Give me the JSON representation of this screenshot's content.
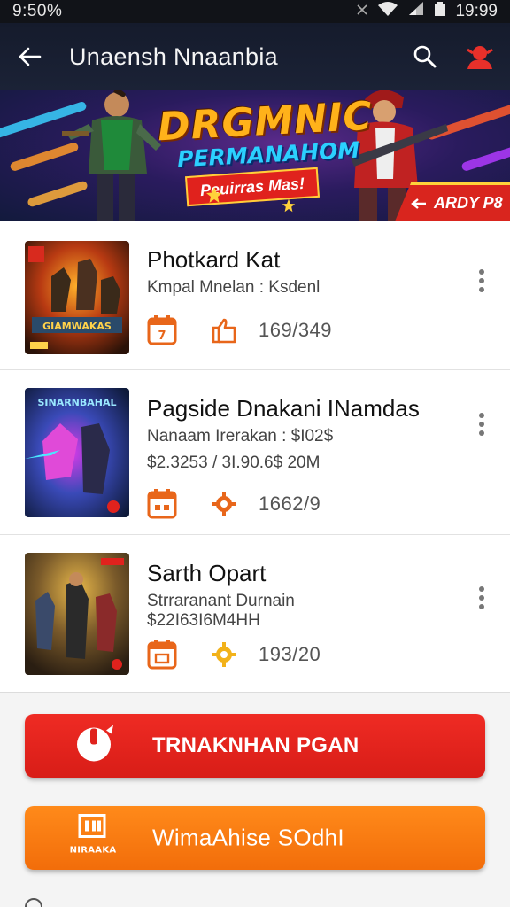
{
  "status_bar": {
    "time_left": "9:50%",
    "time_right": "19:99"
  },
  "app_bar": {
    "title": "Unaensh Nnaanbia",
    "icons": [
      "back-arrow-icon",
      "search-icon",
      "profile-icon"
    ],
    "profile_color": "#e8302a"
  },
  "banner": {
    "title": "DRGMNIC",
    "subtitle": "PERMANAHOM",
    "ribbon": "Peuirras Mas!",
    "tag": "ARDY P8"
  },
  "games": [
    {
      "title": "Photkard Kat",
      "subtitle": "Kmpal Mnelan : Ksdenl",
      "subtitle2": "",
      "count": "169/349",
      "thumb_label": "GIAMWAKAS",
      "meta_icons": [
        "calendar-icon",
        "thumb-up-icon"
      ]
    },
    {
      "title": "Pagside Dnakani INamdas",
      "subtitle": "Nanaam Irerakan : $I02$",
      "subtitle2": "$2.3253 / 3I.90.6$ 20M",
      "count": "1662/9",
      "thumb_label": "SINARNBAHAL",
      "meta_icons": [
        "calendar-icon",
        "gear-icon"
      ]
    },
    {
      "title": "Sarth Opart",
      "subtitle": "Strraranant Durnain",
      "subtitle2": "$22I63I6M4HH",
      "count": "193/20",
      "thumb_label": "",
      "meta_icons": [
        "calendar-icon",
        "gear-icon"
      ]
    }
  ],
  "buttons": {
    "primary": "TRNAKNHAN PGAN",
    "secondary": "WimaAhise SOdhI",
    "secondary_icon_caption": "NIRAAKA"
  },
  "colors": {
    "accent_red": "#e0221d",
    "accent_orange": "#f57a12",
    "icon_orange": "#e8661a"
  }
}
